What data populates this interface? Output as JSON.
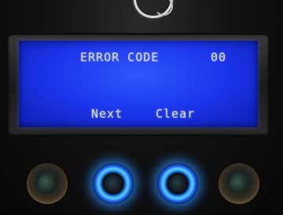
{
  "display": {
    "line1_label": "ERROR CODE",
    "line1_value": "00",
    "softkey_left": "Next",
    "softkey_right": "Clear"
  },
  "buttons": [
    {
      "name": "button-1",
      "lit": false
    },
    {
      "name": "button-2",
      "lit": true
    },
    {
      "name": "button-3",
      "lit": true
    },
    {
      "name": "button-4",
      "lit": false
    }
  ],
  "colors": {
    "lcd_background": "#1a33e8",
    "lcd_text": "#d8dcff",
    "button_glow": "#1e8fff"
  }
}
